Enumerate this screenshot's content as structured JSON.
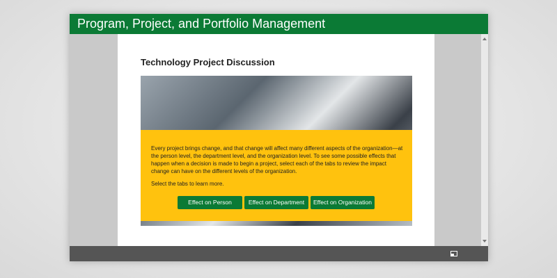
{
  "window": {
    "title": "Program, Project, and Portfolio Management"
  },
  "content": {
    "heading": "Technology Project Discussion",
    "paragraph": "Every project brings change, and that change will affect many different aspects of the organization—at the person level, the department level, and the organization level. To see some possible effects that happen when a decision is made to begin a project, select each of the tabs to review the impact change can have on the different levels of the organization.",
    "instruction": "Select the tabs to learn more.",
    "tabs": [
      {
        "label": "Effect on Person"
      },
      {
        "label": "Effect on Department"
      },
      {
        "label": "Effect on Organization"
      }
    ]
  },
  "colors": {
    "brand_green": "#0b7a35",
    "panel_yellow": "#ffc20e",
    "footer_gray": "#555555"
  },
  "icons": {
    "fullscreen": "fullscreen-icon",
    "scroll_up": "scroll-up-icon",
    "scroll_down": "scroll-down-icon"
  }
}
